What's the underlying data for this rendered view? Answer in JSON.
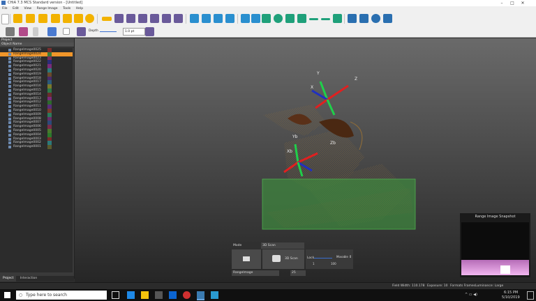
{
  "window": {
    "title": "CHiA 7.3 MCS Standard version - [Untitled]"
  },
  "menu": [
    "File",
    "Edit",
    "View",
    "Range Image",
    "Tools",
    "Help"
  ],
  "toolbar2": {
    "depth_label": "Depth",
    "point_size_value": "1.0 pt"
  },
  "project_panel": {
    "header": "Project",
    "column_header": "Object Name",
    "items": [
      {
        "label": "RangeImage0025",
        "color": "#7a2c2c"
      },
      {
        "label": "RangeImage0024",
        "color": "#3a7a3a",
        "selected": true
      },
      {
        "label": "RangeImage0023",
        "color": "#7a2c5a"
      },
      {
        "label": "RangeImage0022",
        "color": "#2c2c7a"
      },
      {
        "label": "RangeImage0021",
        "color": "#7a2c7a"
      },
      {
        "label": "RangeImage0020",
        "color": "#2c7a7a"
      },
      {
        "label": "RangeImage0019",
        "color": "#6a4a2c"
      },
      {
        "label": "RangeImage0018",
        "color": "#4a2c6a"
      },
      {
        "label": "RangeImage0017",
        "color": "#2c5a7a"
      },
      {
        "label": "RangeImage0016",
        "color": "#7a7a2c"
      },
      {
        "label": "RangeImage0015",
        "color": "#2c7a4a"
      },
      {
        "label": "RangeImage0014",
        "color": "#6a2c2c"
      },
      {
        "label": "RangeImage0013",
        "color": "#7a2c7a"
      },
      {
        "label": "RangeImage0012",
        "color": "#2c6a2c"
      },
      {
        "label": "RangeImage0011",
        "color": "#5a2c7a"
      },
      {
        "label": "RangeImage0010",
        "color": "#7a3a2c"
      },
      {
        "label": "RangeImage0009",
        "color": "#2c7a5a"
      },
      {
        "label": "RangeImage0008",
        "color": "#6a2c6a"
      },
      {
        "label": "RangeImage0007",
        "color": "#2c4a7a"
      },
      {
        "label": "RangeImage0006",
        "color": "#7a2c4a"
      },
      {
        "label": "RangeImage0005",
        "color": "#4a7a2c"
      },
      {
        "label": "RangeImage0004",
        "color": "#2c7a2c"
      },
      {
        "label": "RangeImage0003",
        "color": "#7a2c2c"
      },
      {
        "label": "RangeImage0002",
        "color": "#2c7a7a"
      },
      {
        "label": "RangeImage0001",
        "color": "#5a5a2c"
      }
    ]
  },
  "left_tabs": {
    "project": "Project",
    "interaction": "Interaction"
  },
  "viewport": {
    "axis_labels": {
      "y": "Y",
      "x": "X",
      "z": "Z",
      "yb": "Yb",
      "xb": "Xb",
      "zb": "Zb"
    }
  },
  "control": {
    "mode_label": "Mode",
    "mode_value": "3D Scan",
    "capture_label": "3D Scan",
    "lock_label": "Lock",
    "slider_value": "Movable",
    "range_min": "1",
    "range_max": "100",
    "source_value": "RangeImage",
    "count_value": "25"
  },
  "snapshot": {
    "title": "Range Image Snapshot"
  },
  "status": {
    "field_width": "Field Width: 110.178",
    "exposure": "Exposure: 10",
    "format": "Formats Frames",
    "luminance": "Luminance: Large"
  },
  "taskbar": {
    "search_placeholder": "Type here to search",
    "time": "6:15 PM",
    "date": "5/10/2019"
  },
  "colors": {
    "accent": "#f0962a",
    "plane": "#3e8a3e"
  }
}
